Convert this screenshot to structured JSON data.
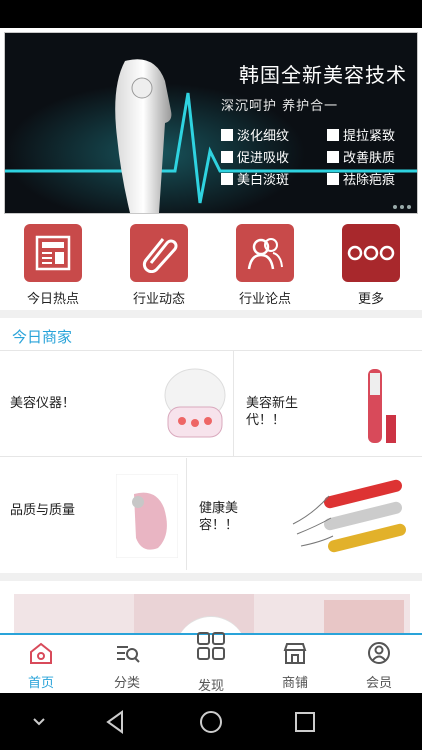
{
  "banner": {
    "title": "韩国全新美容技术",
    "subtitle": "深沉呵护   养护合一",
    "features": [
      "淡化细纹",
      "提拉紧致",
      "促进吸收",
      "改善肤质",
      "美白淡斑",
      "祛除疤痕"
    ]
  },
  "quick_links": [
    {
      "label": "今日热点",
      "icon": "newspaper-icon"
    },
    {
      "label": "行业动态",
      "icon": "paperclip-icon"
    },
    {
      "label": "行业论点",
      "icon": "people-icon"
    },
    {
      "label": "更多",
      "icon": "more-dots-icon"
    }
  ],
  "merchants": {
    "heading": "今日商家",
    "items": [
      {
        "label": "美容仪器！"
      },
      {
        "label": "美容新生代！！"
      },
      {
        "label": "品质与质量"
      },
      {
        "label": "健康美容！！"
      }
    ]
  },
  "tabbar": {
    "items": [
      {
        "label": "首页",
        "icon": "home-icon"
      },
      {
        "label": "分类",
        "icon": "category-search-icon"
      },
      {
        "label": "发现",
        "icon": "grid-icon"
      },
      {
        "label": "商铺",
        "icon": "store-icon"
      },
      {
        "label": "会员",
        "icon": "user-icon"
      }
    ]
  },
  "colors": {
    "accent": "#29a3d9",
    "tile": "#c84a4a"
  }
}
